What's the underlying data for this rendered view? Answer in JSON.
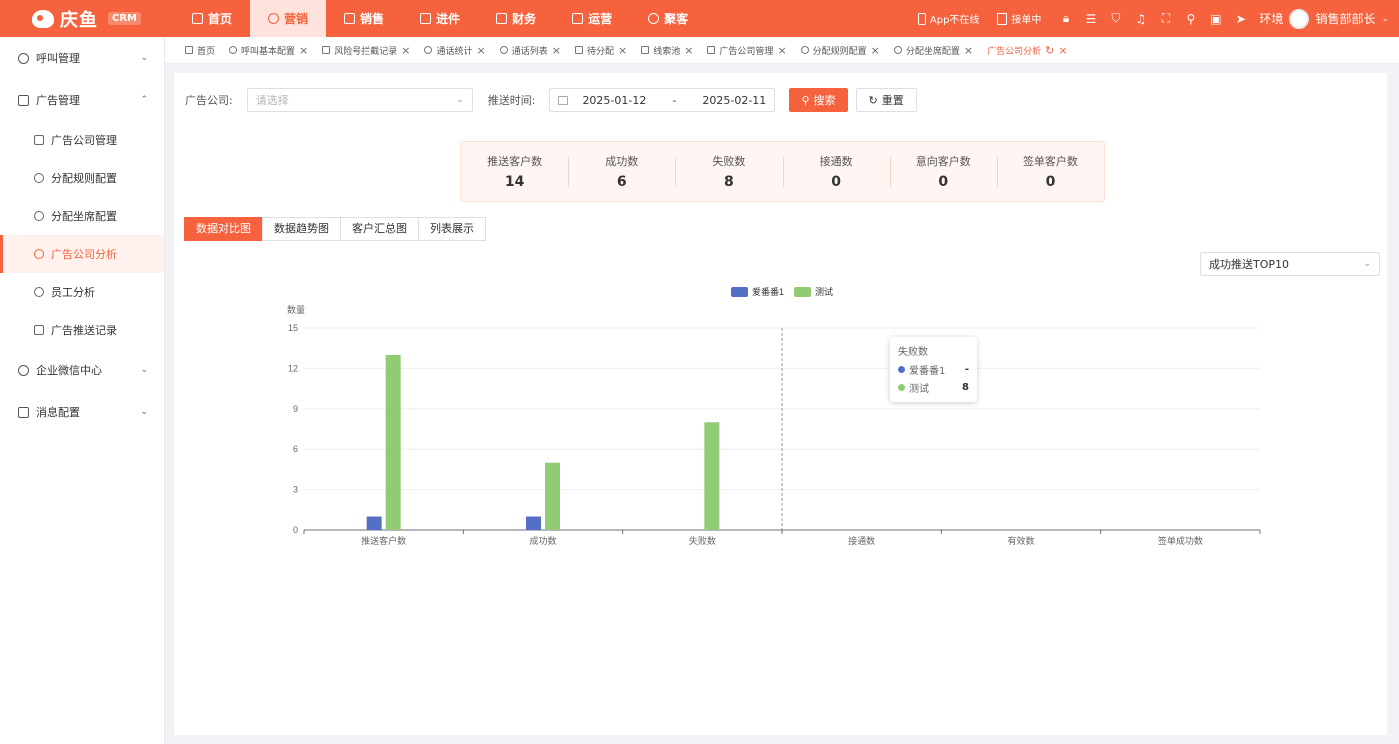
{
  "header": {
    "logo_text": "庆鱼",
    "logo_badge": "CRM",
    "nav": [
      {
        "label": "首页"
      },
      {
        "label": "营销"
      },
      {
        "label": "销售"
      },
      {
        "label": "进件"
      },
      {
        "label": "财务"
      },
      {
        "label": "运营"
      },
      {
        "label": "聚客"
      }
    ],
    "app_status": "App不在线",
    "dispatch_status": "接单中",
    "env_label": "环境",
    "user_name": "销售部部长"
  },
  "sidebar": {
    "groups": [
      {
        "label": "呼叫管理"
      },
      {
        "label": "广告管理"
      },
      {
        "label": "企业微信中心"
      },
      {
        "label": "消息配置"
      }
    ],
    "sub": [
      {
        "label": "广告公司管理"
      },
      {
        "label": "分配规则配置"
      },
      {
        "label": "分配坐席配置"
      },
      {
        "label": "广告公司分析"
      },
      {
        "label": "员工分析"
      },
      {
        "label": "广告推送记录"
      }
    ]
  },
  "tabs": [
    {
      "label": "首页"
    },
    {
      "label": "呼叫基本配置"
    },
    {
      "label": "风险号拦截记录"
    },
    {
      "label": "通话统计"
    },
    {
      "label": "通话列表"
    },
    {
      "label": "待分配"
    },
    {
      "label": "线索池"
    },
    {
      "label": "广告公司管理"
    },
    {
      "label": "分配规则配置"
    },
    {
      "label": "分配坐席配置"
    },
    {
      "label": "广告公司分析"
    }
  ],
  "filter": {
    "company_label": "广告公司:",
    "company_placeholder": "请选择",
    "time_label": "推送时间:",
    "date_start": "2025-01-12",
    "date_sep": "-",
    "date_end": "2025-02-11",
    "search_label": "搜索",
    "reset_label": "重置"
  },
  "stats": [
    {
      "label": "推送客户数",
      "value": "14"
    },
    {
      "label": "成功数",
      "value": "6"
    },
    {
      "label": "失败数",
      "value": "8"
    },
    {
      "label": "接通数",
      "value": "0"
    },
    {
      "label": "意向客户数",
      "value": "0"
    },
    {
      "label": "签单客户数",
      "value": "0"
    }
  ],
  "segments": [
    {
      "label": "数据对比图"
    },
    {
      "label": "数据趋势图"
    },
    {
      "label": "客户汇总图"
    },
    {
      "label": "列表展示"
    }
  ],
  "top10_select": "成功推送TOP10",
  "tooltip": {
    "title": "失败数",
    "rows": [
      {
        "name": "爱番番1",
        "value": "-"
      },
      {
        "name": "测试",
        "value": "8"
      }
    ]
  },
  "colors": {
    "accent": "#f5623d",
    "series1": "#5470c6",
    "series2": "#91cc75"
  },
  "chart_data": {
    "type": "bar",
    "ylabel": "数量",
    "ylim": [
      0,
      15
    ],
    "yticks": [
      0,
      3,
      6,
      9,
      12,
      15
    ],
    "categories": [
      "推送客户数",
      "成功数",
      "失败数",
      "接通数",
      "有效数",
      "签单成功数"
    ],
    "series": [
      {
        "name": "爱番番1",
        "values": [
          1,
          1,
          null,
          null,
          null,
          null
        ]
      },
      {
        "name": "测试",
        "values": [
          13,
          5,
          8,
          null,
          null,
          null
        ]
      }
    ],
    "legend": "top-center",
    "grid": true
  }
}
